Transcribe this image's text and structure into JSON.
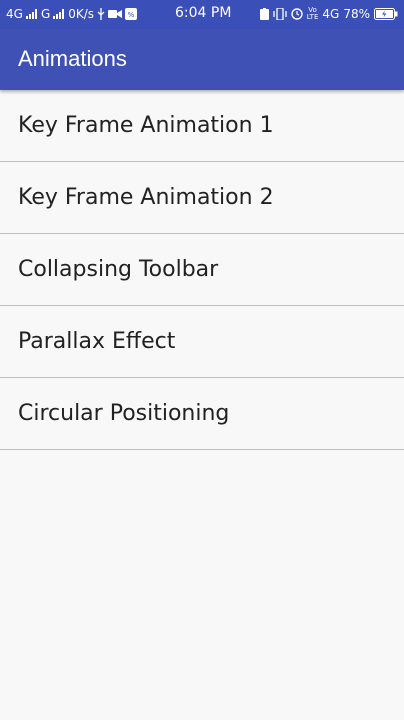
{
  "status_bar": {
    "network1": "4G",
    "network2": "G",
    "speed": "0K/s",
    "time": "6:04 PM",
    "volte": "Vo\nLTE",
    "network3": "4G",
    "battery": "78%"
  },
  "toolbar": {
    "title": "Animations"
  },
  "list": {
    "items": [
      {
        "label": "Key Frame Animation 1"
      },
      {
        "label": "Key Frame Animation 2"
      },
      {
        "label": "Collapsing Toolbar"
      },
      {
        "label": "Parallax Effect"
      },
      {
        "label": "Circular Positioning"
      }
    ]
  },
  "colors": {
    "primary": "#3f51b5",
    "status_bar": "#3b4fb8",
    "background": "#f7f8f7",
    "divider": "#bdbdbd",
    "text": "#222222"
  }
}
